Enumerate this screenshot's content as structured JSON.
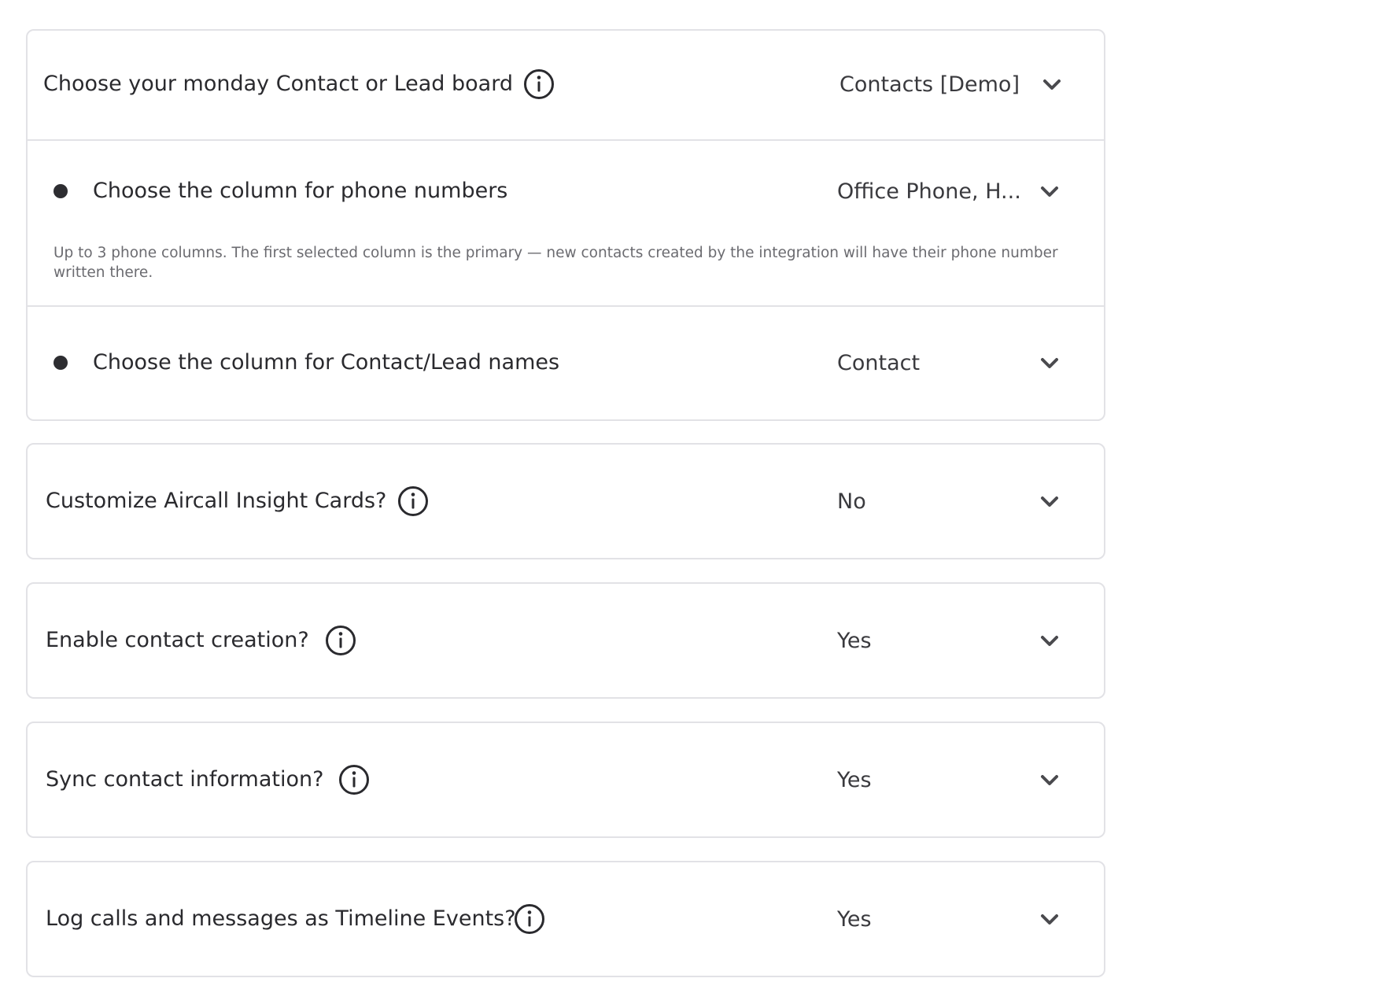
{
  "board_card": {
    "board": {
      "label": "Choose your monday Contact or Lead board",
      "icon": "info-icon",
      "value": "Contacts [Demo]"
    },
    "phone_column": {
      "label": "Choose the column for phone numbers",
      "value": "Office Phone, H...",
      "helper": "Up to 3 phone columns. The first selected column is the primary — new contacts created by the integration will have their phone number written there."
    },
    "name_column": {
      "label": "Choose the column for Contact/Lead names",
      "value": "Contact"
    }
  },
  "insight_cards": {
    "label": "Customize Aircall Insight Cards?",
    "icon": "info-icon",
    "value": "No"
  },
  "contact_creation": {
    "label": "Enable contact creation?",
    "icon": "info-icon",
    "value": "Yes"
  },
  "sync_contact": {
    "label": "Sync contact information?",
    "icon": "info-icon",
    "value": "Yes"
  },
  "timeline_events": {
    "label": "Log calls and messages as Timeline Events?",
    "icon": "info-icon",
    "value": "Yes"
  },
  "colors": {
    "text": "#2a2a2e",
    "helper_text": "#6b6b70",
    "border": "#e2e2e6",
    "chevron": "#4a4a4e"
  }
}
